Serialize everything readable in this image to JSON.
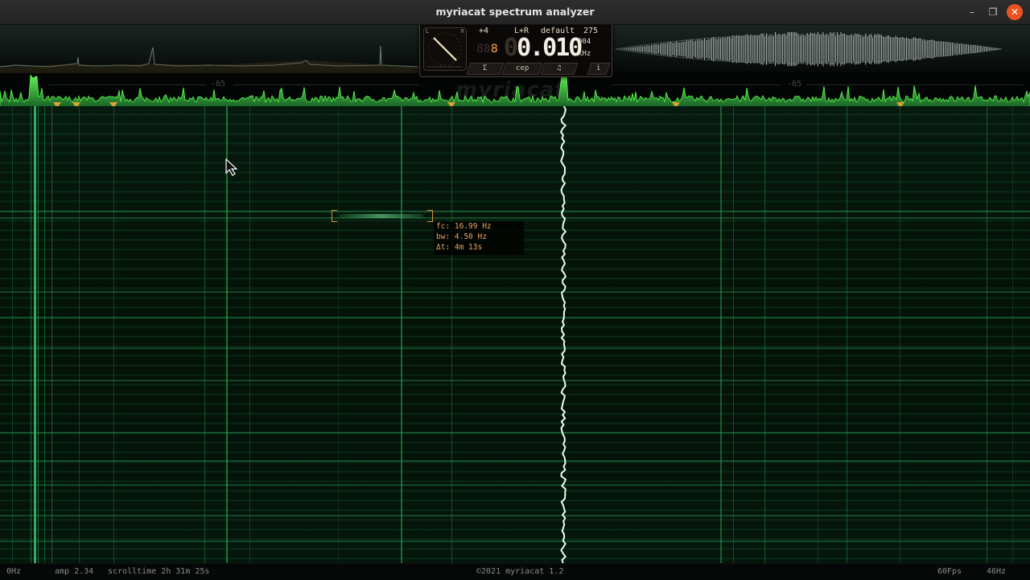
{
  "window": {
    "title": "myriacat spectrum analyzer"
  },
  "controls": {
    "minimize": "–",
    "maximize": "❐",
    "close": "✕"
  },
  "panel": {
    "gauge_left": "L",
    "gauge_right": "R",
    "gain": "+4",
    "channel": "L+R",
    "preset": "default",
    "preset_number": "275",
    "octave_digits": "88",
    "octave_lit": "8",
    "freq_dim": "0",
    "freq_lit": "0.010",
    "freq_sub": "004",
    "unit": "kHz",
    "buttons": [
      "Σ",
      "cep",
      "♫",
      "i"
    ]
  },
  "spectrum": {
    "db_left": "-85",
    "db_right": "-85"
  },
  "watermark": "myriacat",
  "tooltip": {
    "fc": "fc: 16.99 Hz",
    "bw": "bw: 4.50 Hz",
    "dt": "Δt: 4m 13s"
  },
  "status": {
    "start_freq": "0Hz",
    "amp": "amp 2.34",
    "scrolltime": "scrolltime 2h 31m 25s",
    "copyright": "©2021 myriacat 1.2",
    "fps": "60Fps",
    "end_freq": "46Hz"
  },
  "colors": {
    "accent": "#e95420",
    "trace": "#3fd94a",
    "marker": "#d9a032",
    "tooltip_text": "#e8a35e"
  }
}
